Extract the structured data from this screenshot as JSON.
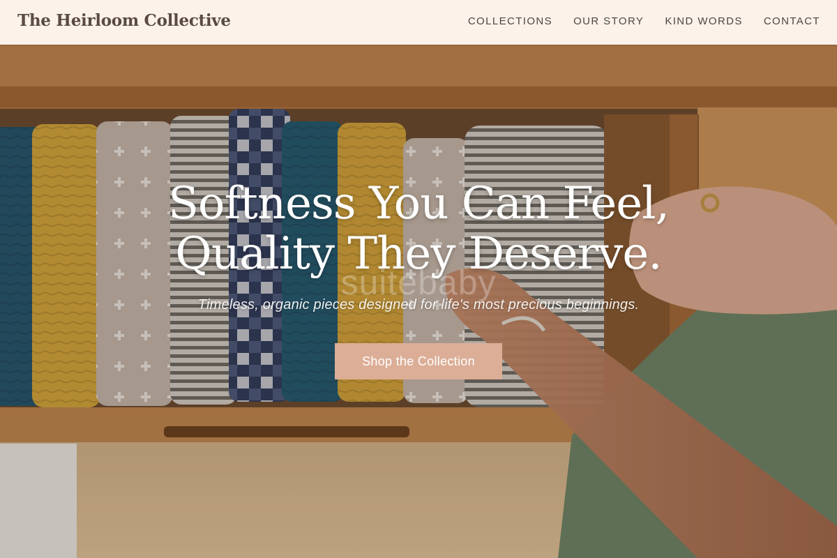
{
  "brand": {
    "name": "The Heirloom Collective"
  },
  "nav": {
    "items": [
      {
        "label": "COLLECTIONS"
      },
      {
        "label": "OUR STORY"
      },
      {
        "label": "KIND WORDS"
      },
      {
        "label": "CONTACT"
      }
    ]
  },
  "hero": {
    "headline_line1": "Softness You Can Feel,",
    "headline_line2": "Quality They Deserve.",
    "watermark": "suitebaby",
    "tagline": "Timeless, organic pieces designed for life's most precious beginnings.",
    "cta_label": "Shop the Collection",
    "background_image": "Overhead view of a wooden drawer holding rolled muslin blankets in teal, mustard, oatmeal and striped patterns, with a hand reaching in"
  },
  "colors": {
    "header_bg": "#fcf2ea",
    "brand_text": "#5a4a42",
    "nav_text": "#4e4540",
    "cta_bg": "#dcae97",
    "cta_text": "#ffffff",
    "headline_text": "#ffffff"
  }
}
